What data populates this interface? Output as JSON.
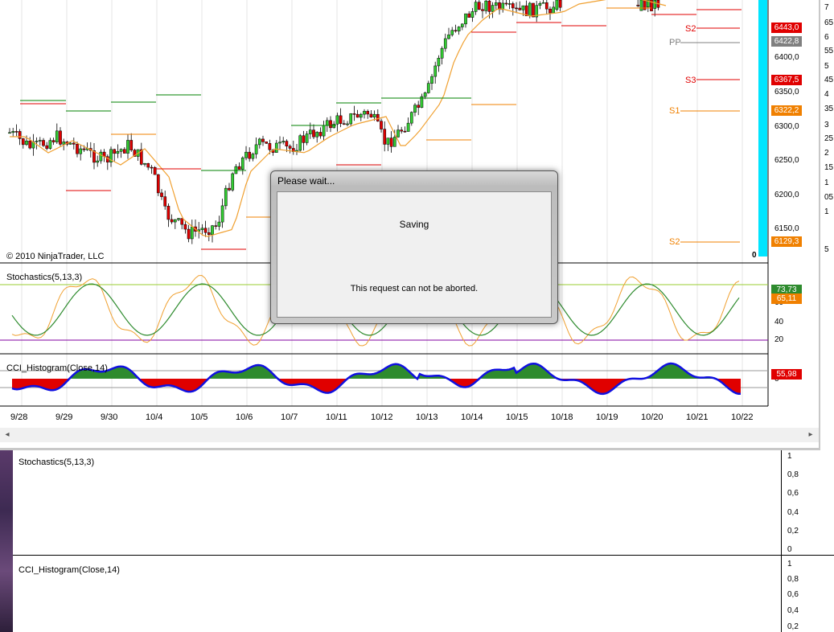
{
  "background_window": {
    "panels": [
      {
        "label": "Stochastics(5,13,3)",
        "ticks": [
          "1",
          "0,8",
          "0,6",
          "0,4",
          "0,2",
          "0"
        ]
      },
      {
        "label": "CCI_Histogram(Close,14)",
        "ticks": [
          "1",
          "0,8",
          "0,6",
          "0,4",
          "0,2"
        ]
      }
    ]
  },
  "chart": {
    "copyright": "© 2010 NinjaTrader, LLC",
    "price_axis": [
      "6400,0",
      "6350,0",
      "6300,0",
      "6250,0",
      "6200,0",
      "6150,0"
    ],
    "price_tags": [
      {
        "text": "6443,0",
        "color": "#e00000"
      },
      {
        "text": "6422,8",
        "color": "#808080"
      },
      {
        "text": "6367,5",
        "color": "#e00000"
      },
      {
        "text": "6322,2",
        "color": "#f08000"
      },
      {
        "text": "6129,3",
        "color": "#f08000"
      }
    ],
    "pivot_labels": [
      {
        "text": "S2",
        "color": "#e00000"
      },
      {
        "text": "PP",
        "color": "#808080"
      },
      {
        "text": "S3",
        "color": "#e00000"
      },
      {
        "text": "S1",
        "color": "#f08000"
      },
      {
        "text": "S2",
        "color": "#f08000"
      }
    ],
    "zero_label": "0",
    "stoch_panel": {
      "label": "Stochastics(5,13,3)",
      "axis": [
        "60",
        "40",
        "20"
      ],
      "tag_d": "73,73",
      "tag_k": "65,11"
    },
    "cci_panel": {
      "label": "CCI_Histogram(Close,14)",
      "axis": [
        "0"
      ],
      "tag": "55,98"
    },
    "dates": [
      "9/28",
      "9/29",
      "9/30",
      "10/4",
      "10/5",
      "10/6",
      "10/7",
      "10/11",
      "10/12",
      "10/13",
      "10/14",
      "10/15",
      "10/18",
      "10/19",
      "10/20",
      "10/21",
      "10/22"
    ],
    "far_right_numbers": [
      "7",
      "65",
      "6",
      "55",
      "5",
      "45",
      "4",
      "35",
      "3",
      "25",
      "2",
      "15",
      "1",
      "05",
      "1",
      "5"
    ]
  },
  "dialog": {
    "title": "Please wait...",
    "status": "Saving",
    "message": "This request can not be aborted."
  }
}
